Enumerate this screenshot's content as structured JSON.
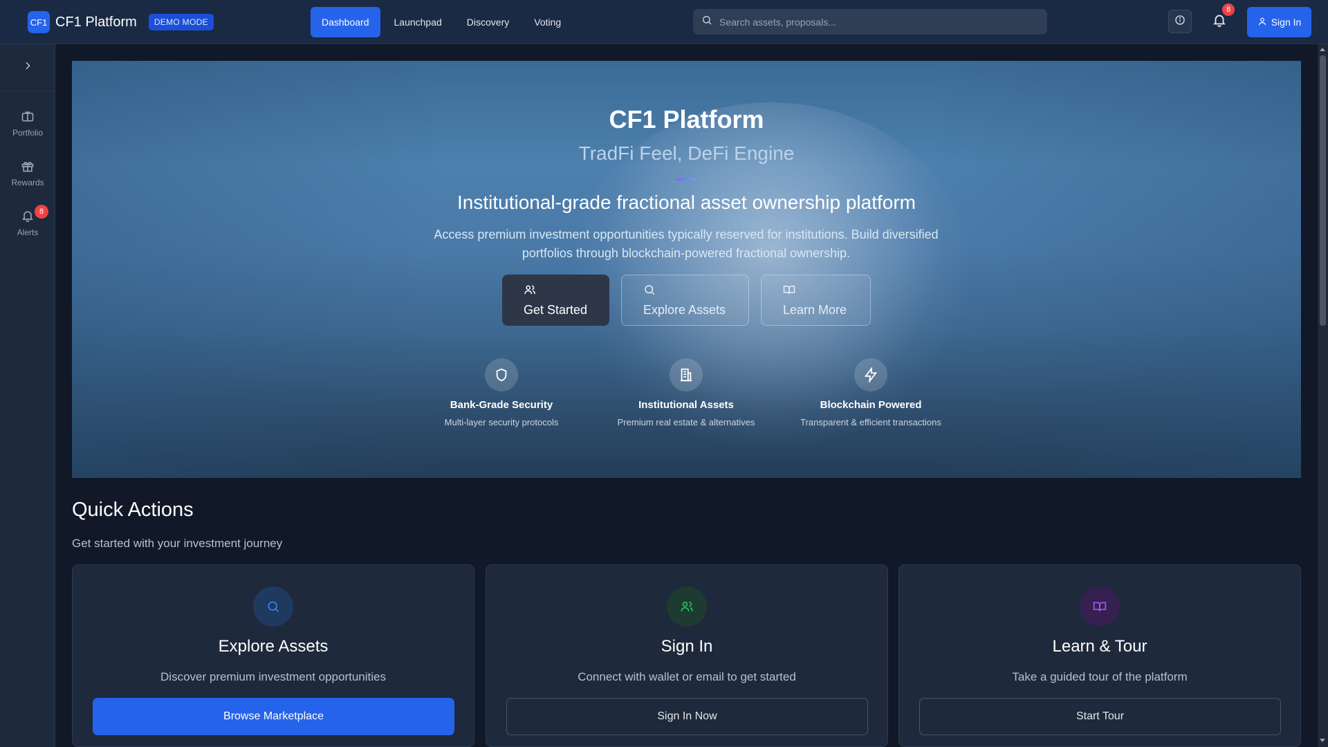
{
  "header": {
    "logo_text": "CF1",
    "brand": "CF1 Platform",
    "badge": "DEMO MODE",
    "nav": [
      {
        "label": "Dashboard",
        "active": true
      },
      {
        "label": "Launchpad",
        "active": false
      },
      {
        "label": "Discovery",
        "active": false
      },
      {
        "label": "Voting",
        "active": false
      }
    ],
    "search_placeholder": "Search assets, proposals...",
    "notification_count": "8",
    "signin_label": "Sign In"
  },
  "sidebar": {
    "items": [
      {
        "label": "Portfolio",
        "icon": "briefcase-icon"
      },
      {
        "label": "Rewards",
        "icon": "gift-icon"
      },
      {
        "label": "Alerts",
        "icon": "bell-icon",
        "badge": "8"
      }
    ]
  },
  "hero": {
    "title": "CF1 Platform",
    "subtitle": "TradFi Feel, DeFi Engine",
    "tagline": "Institutional-grade fractional asset ownership platform",
    "description": "Access premium investment opportunities typically reserved for institutions. Build diversified portfolios through blockchain-powered fractional ownership.",
    "buttons": [
      {
        "label": "Get Started",
        "icon": "users-icon"
      },
      {
        "label": "Explore Assets",
        "icon": "search-icon"
      },
      {
        "label": "Learn More",
        "icon": "book-icon"
      }
    ],
    "features": [
      {
        "title": "Bank-Grade Security",
        "desc": "Multi-layer security protocols",
        "icon": "shield-icon"
      },
      {
        "title": "Institutional Assets",
        "desc": "Premium real estate & alternatives",
        "icon": "building-icon"
      },
      {
        "title": "Blockchain Powered",
        "desc": "Transparent & efficient transactions",
        "icon": "lightning-icon"
      }
    ]
  },
  "quick_actions": {
    "title": "Quick Actions",
    "subtitle": "Get started with your investment journey",
    "cards": [
      {
        "title": "Explore Assets",
        "desc": "Discover premium investment opportunities",
        "button": "Browse Marketplace",
        "icon": "search-icon",
        "color": "#2563eb"
      },
      {
        "title": "Sign In",
        "desc": "Connect with wallet or email to get started",
        "button": "Sign In Now",
        "icon": "users-icon",
        "color": "#22c55e"
      },
      {
        "title": "Learn & Tour",
        "desc": "Take a guided tour of the platform",
        "button": "Start Tour",
        "icon": "book-icon",
        "color": "#a855f7"
      }
    ]
  },
  "colors": {
    "accent": "#2563eb",
    "background": "#111827",
    "badge_red": "#ef4444"
  }
}
